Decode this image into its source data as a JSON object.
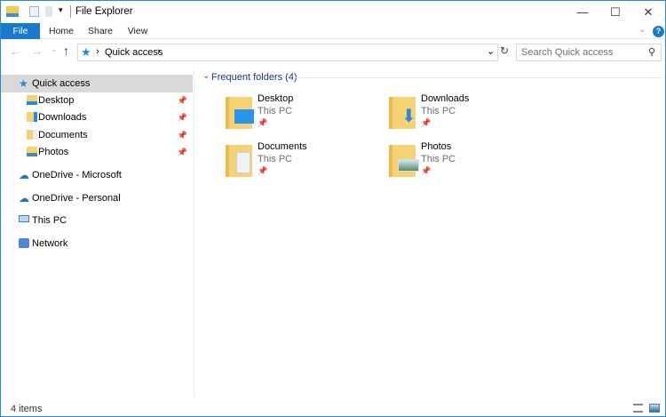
{
  "window": {
    "title": "File Explorer",
    "minimize": "—",
    "maximize": "☐",
    "close": "✕"
  },
  "ribbon": {
    "tabs": [
      "File",
      "Home",
      "Share",
      "View"
    ],
    "help": "?"
  },
  "nav": {
    "back": "←",
    "forward": "→",
    "recent": "⌄",
    "up": "↑",
    "breadcrumb": "Quick access",
    "sep": "›",
    "dropdown": "⌄",
    "refresh": "↻",
    "search_placeholder": "Search Quick access",
    "search_icon": "⚲"
  },
  "sidebar": {
    "items": [
      {
        "label": "Quick access",
        "icon": "star-icon",
        "selected": true
      },
      {
        "label": "Desktop",
        "icon": "folder-icon",
        "pinned": true
      },
      {
        "label": "Downloads",
        "icon": "folder-icon",
        "pinned": true
      },
      {
        "label": "Documents",
        "icon": "folder-icon",
        "pinned": true
      },
      {
        "label": "Photos",
        "icon": "folder-icon",
        "pinned": true
      },
      {
        "label": "OneDrive - Microsoft",
        "icon": "cloud-icon"
      },
      {
        "label": "OneDrive - Personal",
        "icon": "cloud-icon"
      },
      {
        "label": "This PC",
        "icon": "computer-icon"
      },
      {
        "label": "Network",
        "icon": "network-icon"
      }
    ],
    "pin": "📌"
  },
  "main": {
    "group_title": "Frequent folders (4)",
    "folders": [
      {
        "name": "Desktop",
        "location": "This PC"
      },
      {
        "name": "Downloads",
        "location": "This PC"
      },
      {
        "name": "Documents",
        "location": "This PC"
      },
      {
        "name": "Photos",
        "location": "This PC"
      }
    ]
  },
  "status": {
    "count": "4 items"
  },
  "colors": {
    "accent": "#1979ca",
    "selected": "#d9d9d9",
    "group": "#1e3287"
  }
}
